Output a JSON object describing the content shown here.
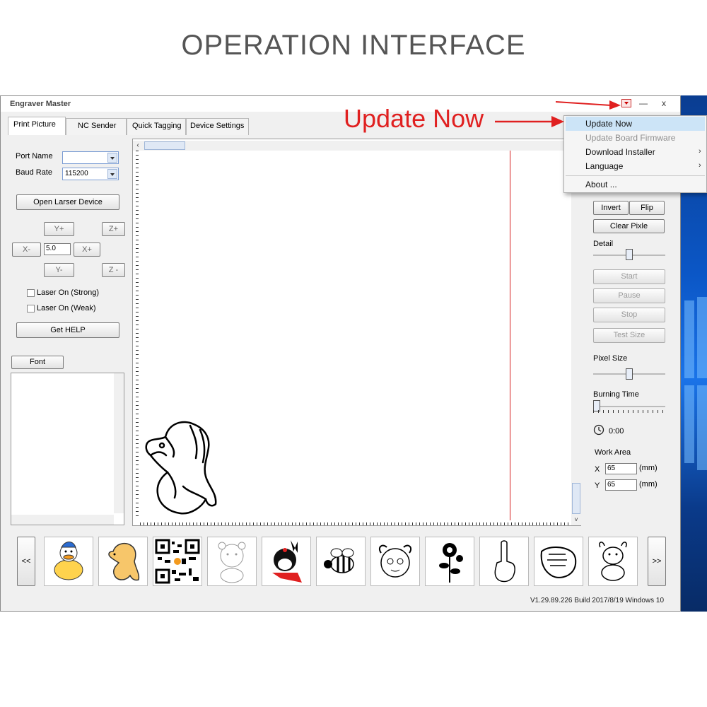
{
  "page_title": "OPERATION INTERFACE",
  "annotation": "Update Now",
  "window": {
    "title": "Engraver Master",
    "minimize": "—",
    "close": "x"
  },
  "tabs": [
    {
      "label": "Print Picture",
      "active": true
    },
    {
      "label": "NC Sender"
    },
    {
      "label": "Quick Tagging"
    },
    {
      "label": "Device Settings"
    }
  ],
  "left": {
    "port_label": "Port Name",
    "port_value": "",
    "baud_label": "Baud Rate",
    "baud_value": "115200",
    "open_device": "Open Larser Device",
    "y_plus": "Y+",
    "z_plus": "Z+",
    "x_minus": "X-",
    "step_value": "5.0",
    "x_plus": "X+",
    "y_minus": "Y-",
    "z_minus": "Z -",
    "laser_strong": "Laser On (Strong)",
    "laser_weak": "Laser On (Weak)",
    "get_help": "Get HELP",
    "font": "Font"
  },
  "menu": {
    "items": [
      {
        "label": "Update Now",
        "highlighted": true
      },
      {
        "label": "Update Board Firmware",
        "disabled": true
      },
      {
        "label": "Download Installer",
        "submenu": true
      },
      {
        "label": "Language",
        "submenu": true
      },
      {
        "label": "About ..."
      }
    ]
  },
  "right": {
    "invert": "Invert",
    "flip": "Flip",
    "clear_pixel": "Clear Pixle",
    "detail_label": "Detail",
    "detail_level": 0.5,
    "start": "Start",
    "pause": "Pause",
    "stop": "Stop",
    "test_size": "Test Size",
    "pixel_size_label": "Pixel Size",
    "pixel_size_level": 0.5,
    "burning_time_label": "Burning Time",
    "burning_time_level": 0.0,
    "timer": "0:00",
    "work_area_label": "Work Area",
    "x_label": "X",
    "x_value": "65",
    "x_unit": "(mm)",
    "y_label": "Y",
    "y_value": "65",
    "y_unit": "(mm)"
  },
  "nav": {
    "prev": "<<",
    "next": ">>"
  },
  "thumbnails": [
    "duck",
    "horse",
    "qr-code",
    "bear",
    "girl-bunny",
    "bee",
    "sheep",
    "rose",
    "hand",
    "fist",
    "cow"
  ],
  "status": "V1.29.89.226 Build 2017/8/19 Windows 10",
  "colors": {
    "annotation": "#e02020",
    "menu_highlight": "#cce4f7",
    "red_line": "#d62020"
  }
}
